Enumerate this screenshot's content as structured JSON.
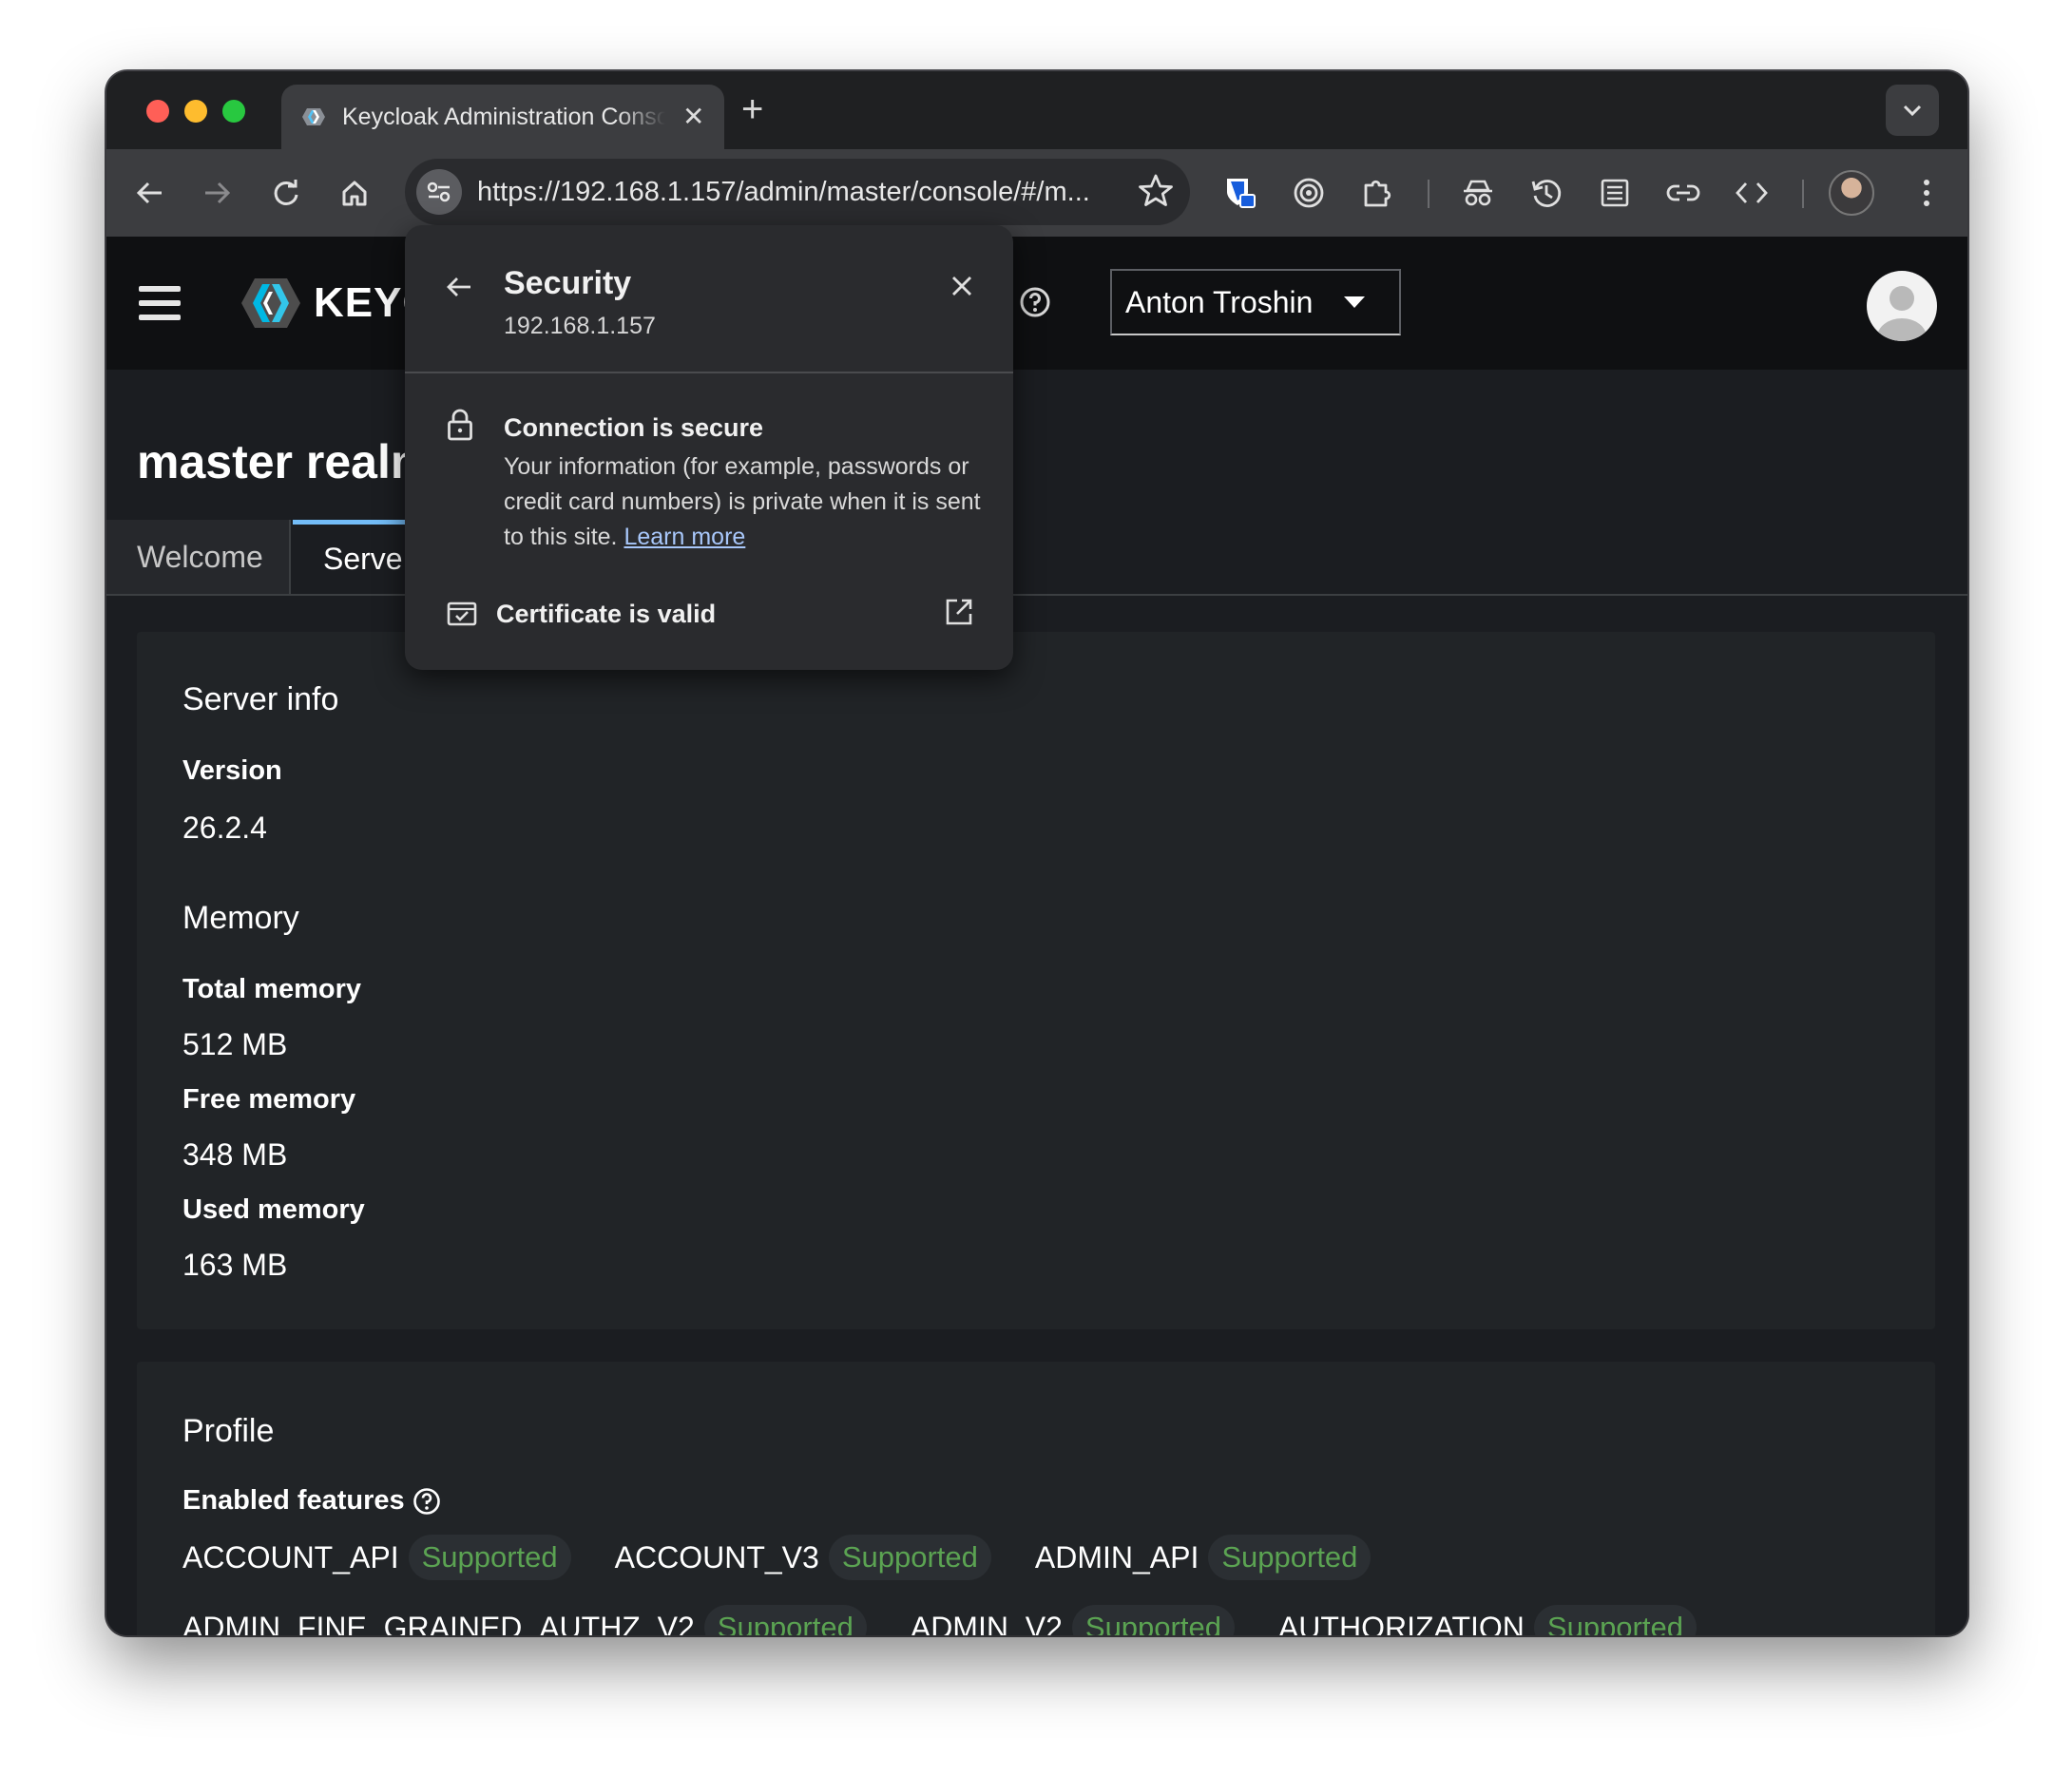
{
  "browser": {
    "tab_title": "Keycloak Administration Console",
    "url": "https://192.168.1.157/admin/master/console/#/m..."
  },
  "header": {
    "logo_text": "KEYC",
    "user_name": "Anton Troshin"
  },
  "page": {
    "title": "master realm",
    "tabs": [
      {
        "label": "Welcome",
        "active": false
      },
      {
        "label": "Serve",
        "active": true
      }
    ]
  },
  "server_info": {
    "heading": "Server info",
    "version_label": "Version",
    "version_value": "26.2.4",
    "memory_heading": "Memory",
    "total_label": "Total memory",
    "total_value": "512 MB",
    "free_label": "Free memory",
    "free_value": "348 MB",
    "used_label": "Used memory",
    "used_value": "163 MB"
  },
  "profile": {
    "heading": "Profile",
    "enabled_label": "Enabled features",
    "features_row1": [
      {
        "name": "ACCOUNT_API",
        "badge": "Supported"
      },
      {
        "name": "ACCOUNT_V3",
        "badge": "Supported"
      },
      {
        "name": "ADMIN_API",
        "badge": "Supported"
      }
    ],
    "features_row2": [
      {
        "name": "ADMIN_FINE_GRAINED_AUTHZ_V2",
        "badge": "Supported"
      },
      {
        "name": "ADMIN_V2",
        "badge": "Supported"
      },
      {
        "name": "AUTHORIZATION",
        "badge": "Supported"
      }
    ]
  },
  "security_popup": {
    "title": "Security",
    "host": "192.168.1.157",
    "connection_title": "Connection is secure",
    "connection_desc": "Your information (for example, passwords or credit card numbers) is private when it is sent to this site.",
    "learn_more": "Learn more",
    "certificate_label": "Certificate is valid"
  },
  "colors": {
    "accent_tab": "#73bcf7",
    "supported_green": "#5ba352",
    "header_bg": "#0f1012"
  }
}
